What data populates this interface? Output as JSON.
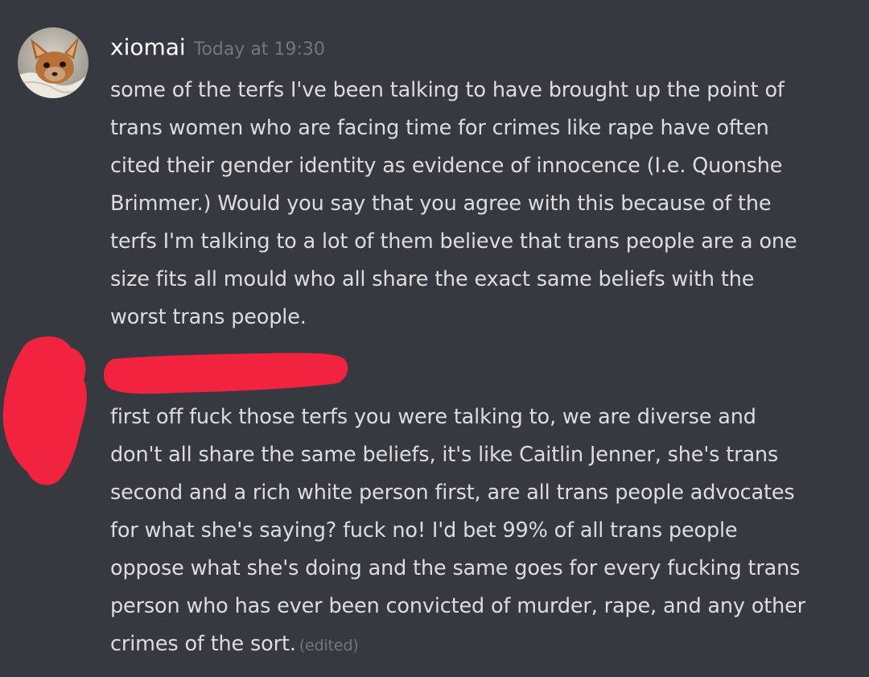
{
  "message": {
    "author": "xiomai",
    "timestamp": "Today at 19:30",
    "lines_1": "some of the terfs I've been talking to have brought up the point of\ntrans women who are facing time for crimes like rape have often\ncited their gender identity as evidence of innocence (I.e. Quonshe\nBrimmer.) Would you say that you agree with this because of the\nterfs I'm talking to a lot of them believe that trans people are a one\nsize fits all mould who all share the exact same beliefs with the\nworst trans people.",
    "lines_2": "first off fuck those terfs you were talking to, we are diverse and\ndon't all share the same beliefs, it's like Caitlin Jenner, she's trans\nsecond and a rich white person first, are all trans people advocates\nfor what she's saying? fuck no! I'd bet 99% of all trans people\noppose what she's doing and the same goes for every fucking trans\nperson who has ever been convicted of murder, rape, and any other\ncrimes of the sort.",
    "edited_label": "(edited)"
  },
  "colors": {
    "background": "#36393f",
    "text": "#dcddde",
    "username": "#ffffff",
    "muted": "#72767d",
    "redaction": "#f2233e"
  },
  "icons": {
    "avatar": "chihuahua-avatar-icon"
  }
}
